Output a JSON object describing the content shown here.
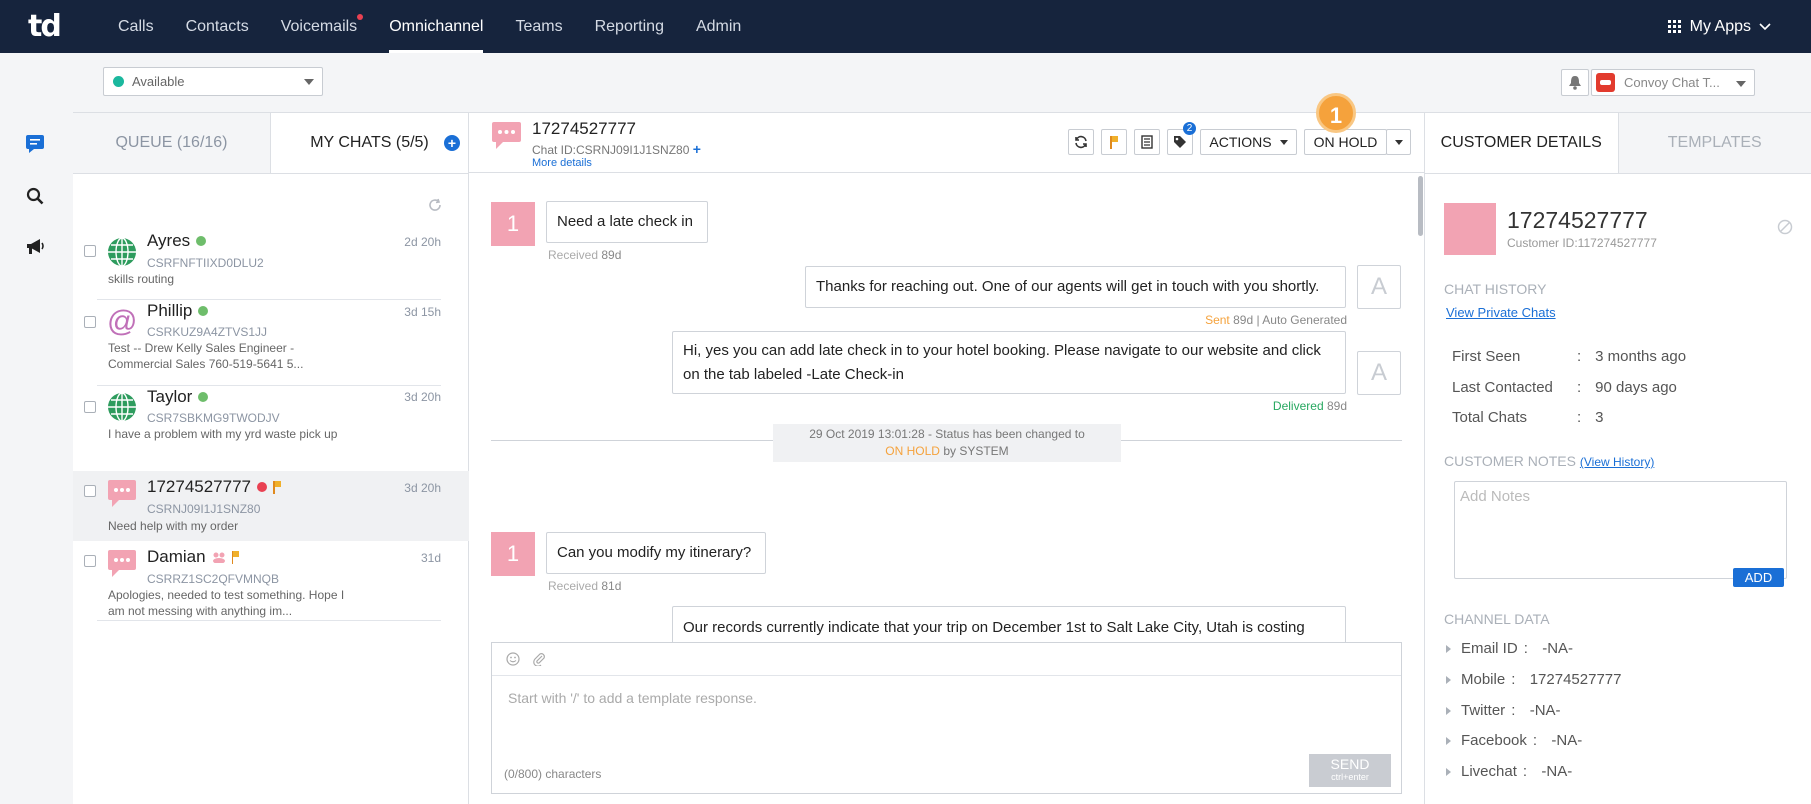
{
  "app": {
    "logo": "td"
  },
  "nav": {
    "items": [
      "Calls",
      "Contacts",
      "Voicemails",
      "Omnichannel",
      "Teams",
      "Reporting",
      "Admin"
    ],
    "active": "Omnichannel",
    "my_apps": "My Apps"
  },
  "status": {
    "value": "Available",
    "convoy": "Convoy Chat T..."
  },
  "chat_list": {
    "tabs": {
      "queue": "QUEUE (16/16)",
      "my_chats": "MY CHATS (5/5)"
    },
    "items": [
      {
        "name": "Ayres",
        "id": "CSRFNFTIIXD0DLU2",
        "preview": "skills routing",
        "time": "2d 20h"
      },
      {
        "name": "Phillip",
        "id": "CSRKUZ9A4ZTVS1JJ",
        "preview": "Test -- Drew Kelly Sales Engineer - Commercial Sales 760-519-5641 5...",
        "time": "3d 15h"
      },
      {
        "name": "Taylor",
        "id": "CSR7SBKMG9TWODJV",
        "preview": "I have a problem with my yrd waste pick up",
        "time": "3d 20h"
      },
      {
        "name": "17274527777",
        "id": "CSRNJ09I1J1SNZ80",
        "preview": "Need help with my order",
        "time": "3d 20h"
      },
      {
        "name": "Damian",
        "id": "CSRRZ1SC2QFVMNQB",
        "preview": "Apologies, needed to test something. Hope I am not messing with anything im...",
        "time": "31d"
      }
    ]
  },
  "chat": {
    "title": "17274527777",
    "chat_id": "Chat ID:CSRNJ09I1J1SNZ80",
    "more_details": "More details",
    "toolbar": {
      "tag_count": "2",
      "actions": "ACTIONS",
      "status": "ON HOLD",
      "badge": "1"
    },
    "messages": [
      {
        "text": "Need a late check in",
        "avatar": "1",
        "status": "Received",
        "age": "89d"
      },
      {
        "text": "Thanks for reaching out. One of our agents will get in touch with you shortly.",
        "avatar": "A",
        "status": "Sent",
        "age": "89d",
        "note": "| Auto Generated"
      },
      {
        "text": "Hi, yes you can add late check in to your hotel booking. Please navigate to our website and click on the tab labeled -Late Check-in",
        "avatar": "A",
        "status": "Delivered",
        "age": "89d"
      },
      {
        "text": "Can you modify my itinerary?",
        "avatar": "1",
        "status": "Received",
        "age": "81d"
      },
      {
        "text": "Our records currently indicate that your trip on December 1st to Salt Lake City, Utah is costing"
      }
    ],
    "system": {
      "line1": "29 Oct 2019 13:01:28 - Status has been changed to",
      "status": "ON HOLD",
      "by": "by SYSTEM"
    },
    "composer": {
      "placeholder": "Start with '/' to add a template response.",
      "count": "(0/800) characters",
      "send": "SEND",
      "send_hint": "ctrl+enter"
    }
  },
  "customer": {
    "tabs": {
      "details": "CUSTOMER DETAILS",
      "templates": "TEMPLATES"
    },
    "name": "17274527777",
    "id": "Customer ID:117274527777",
    "chat_history_label": "CHAT HISTORY",
    "view_private": "View Private Chats",
    "stats": [
      {
        "k": "First Seen",
        "v": "3 months ago"
      },
      {
        "k": "Last Contacted",
        "v": "90 days ago"
      },
      {
        "k": "Total Chats",
        "v": "3"
      }
    ],
    "notes_label": "CUSTOMER NOTES",
    "view_history": "(View History)",
    "notes_placeholder": "Add Notes",
    "add": "ADD",
    "channel_label": "CHANNEL DATA",
    "channels": [
      {
        "k": "Email ID",
        "v": "-NA-"
      },
      {
        "k": "Mobile",
        "v": "17274527777"
      },
      {
        "k": "Twitter",
        "v": "-NA-"
      },
      {
        "k": "Facebook",
        "v": "-NA-"
      },
      {
        "k": "Livechat",
        "v": "-NA-"
      }
    ]
  },
  "colors": {
    "nav_bg": "#16243d",
    "accent": "#1a6fd6",
    "pink": "#f2a3b3",
    "orange": "#f5a23c",
    "green": "#1bb89e",
    "red": "#e94152"
  }
}
